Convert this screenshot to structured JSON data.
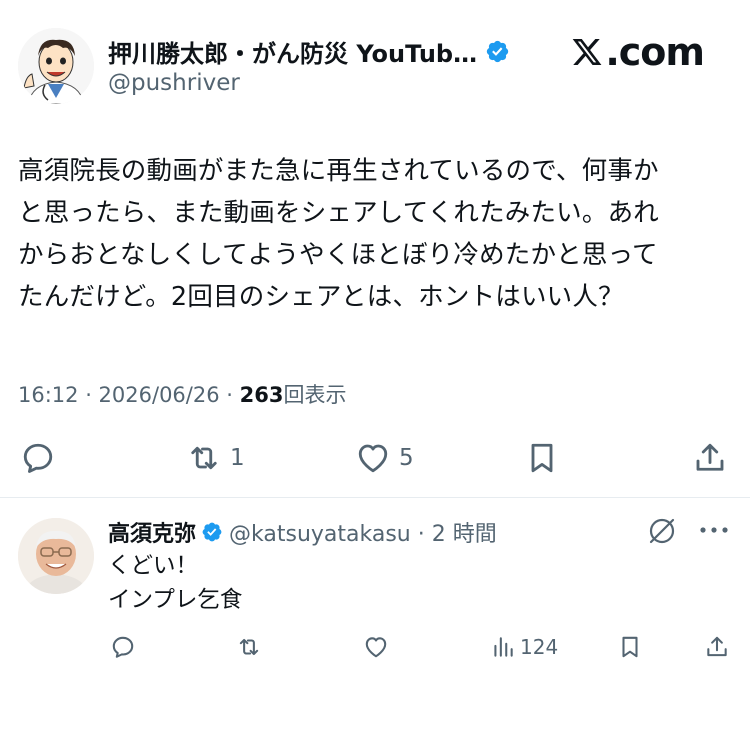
{
  "author": {
    "display_name": "押川勝太郎・がん防災 YouTub…",
    "handle": "@pushriver"
  },
  "brand": {
    "label": ".com"
  },
  "tweet": {
    "text": "高須院長の動画がまた急に再生されているので、何事か\nと思ったら、また動画をシェアしてくれたみたい。あれ\nからおとなしくしてようやくほとぼり冷めたかと思って\nたんだけど。2回目のシェアとは、ホントはいい人？",
    "time": "16:12 · 2026/06/26 · ",
    "views_count": "263",
    "views_label": "回表示"
  },
  "actions": {
    "retweets": "1",
    "likes": "5"
  },
  "reply": {
    "display_name": "高須克弥",
    "handle": "@katsuyatakasu · 2 時間",
    "text": "くどい！\nインプレ乞食",
    "views": "124"
  },
  "colors": {
    "verified": "#1d9bf0",
    "muted": "#536471",
    "text": "#0f1419"
  }
}
